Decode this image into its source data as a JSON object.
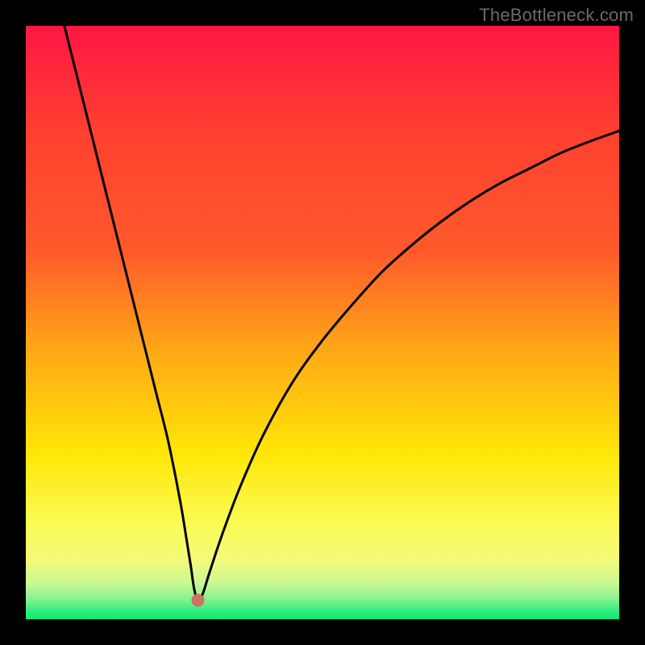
{
  "watermark": "TheBottleneck.com",
  "colors": {
    "frame": "#000000",
    "gradient_top": "#fe1744",
    "gradient_mid1": "#ff5a2b",
    "gradient_mid2": "#ffa916",
    "gradient_mid3": "#ffe607",
    "gradient_mid4": "#fafb54",
    "gradient_bottom": "#07ec72",
    "curve_stroke": "#000000",
    "dot_fill": "#cb7264"
  },
  "chart_data": {
    "type": "line",
    "title": "",
    "xlabel": "",
    "ylabel": "",
    "xlim": [
      0,
      100
    ],
    "ylim": [
      0,
      100
    ],
    "x": [
      6.5,
      8,
      10,
      12,
      14,
      16,
      18,
      20,
      22,
      24,
      26,
      27,
      27.8,
      28.3,
      28.8,
      29.3,
      29.9,
      31,
      33,
      36,
      40,
      45,
      50,
      55,
      60,
      65,
      70,
      75,
      80,
      85,
      90,
      95,
      100
    ],
    "values": [
      100,
      94,
      86,
      78,
      70,
      62,
      54,
      46,
      38,
      30,
      20,
      14,
      9,
      5.5,
      3.5,
      3.3,
      4.5,
      8,
      14,
      22,
      31,
      40,
      47,
      53,
      58.5,
      63,
      67,
      70.5,
      73.5,
      76,
      78.5,
      80.5,
      82.3
    ],
    "minimum_point": {
      "x": 29,
      "y": 3.2
    },
    "grid": false,
    "legend": false
  }
}
